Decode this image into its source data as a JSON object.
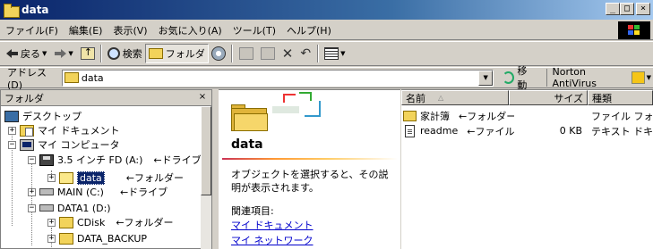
{
  "window": {
    "title": "data",
    "controls": {
      "minimize": "_",
      "maximize": "□",
      "close": "×"
    }
  },
  "menu": [
    "ファイル(F)",
    "編集(E)",
    "表示(V)",
    "お気に入り(A)",
    "ツール(T)",
    "ヘルプ(H)"
  ],
  "toolbar": {
    "back_label": "戻る",
    "search_label": "検索",
    "folders_label": "フォルダ"
  },
  "address": {
    "label": "アドレス(D)",
    "value": "data",
    "go_label": "移動",
    "norton_label": "Norton AntiVirus"
  },
  "folder_pane": {
    "header": "フォルダ",
    "close": "×",
    "items": [
      {
        "label": "デスクトップ",
        "icon": "desktop-icon",
        "expander": "",
        "annotation": ""
      },
      {
        "label": "マイ ドキュメント",
        "icon": "my-documents-icon",
        "expander": "+",
        "annotation": ""
      },
      {
        "label": "マイ コンピュータ",
        "icon": "computer-icon",
        "expander": "−",
        "annotation": ""
      },
      {
        "label": "3.5 インチ FD (A:)",
        "icon": "floppy-icon",
        "expander": "−",
        "annotation": "←ドライブ"
      },
      {
        "label": "data",
        "icon": "folder-open-icon",
        "expander": "+",
        "annotation": "←フォルダー",
        "selected": true
      },
      {
        "label": "MAIN (C:)",
        "icon": "drive-icon",
        "expander": "+",
        "annotation": "←ドライブ"
      },
      {
        "label": "DATA1 (D:)",
        "icon": "drive-icon",
        "expander": "−",
        "annotation": ""
      },
      {
        "label": "CDisk",
        "icon": "folder-icon",
        "expander": "+",
        "annotation": "←フォルダー"
      },
      {
        "label": "DATA_BACKUP",
        "icon": "folder-icon",
        "expander": "+",
        "annotation": ""
      }
    ]
  },
  "webview": {
    "title": "data",
    "description": "オブジェクトを選択すると、その説明が表示されます。",
    "related_label": "関連項目:",
    "links": [
      "マイ ドキュメント",
      "マイ ネットワーク"
    ]
  },
  "list": {
    "columns": [
      "名前",
      "サイズ",
      "種類"
    ],
    "sort_indicator": "△",
    "rows": [
      {
        "name": "家計簿",
        "icon": "folder-icon",
        "annotation": "←フォルダー",
        "size": "",
        "type": "ファイル フォルダ"
      },
      {
        "name": "readme",
        "icon": "text-file-icon",
        "annotation": "←ファイル",
        "size": "0 KB",
        "type": "テキスト ドキュメント"
      }
    ]
  }
}
